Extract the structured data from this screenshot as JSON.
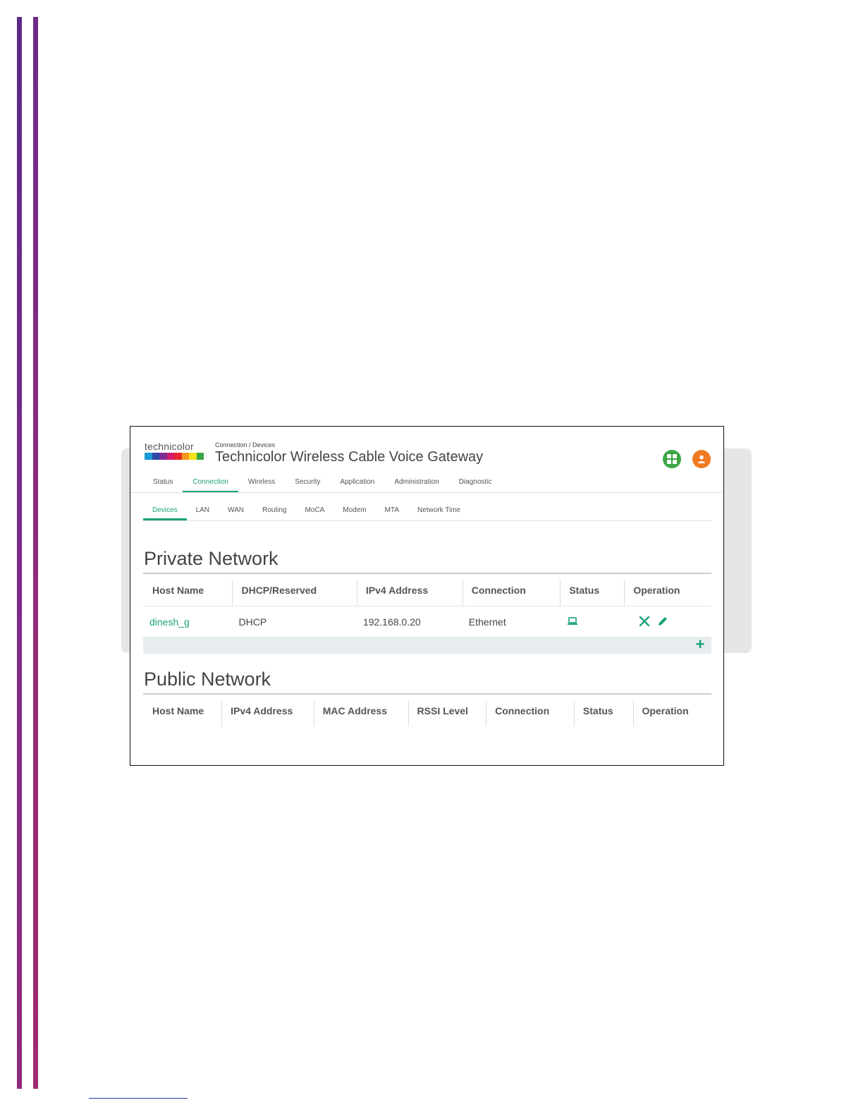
{
  "app": {
    "logo_text": "technicolor",
    "breadcrumb": "Connection / Devices",
    "title": "Technicolor Wireless Cable Voice Gateway",
    "brand_color": "#1aa17a",
    "logo_stripe_colors": [
      "#1b9ad6",
      "#2c4aa6",
      "#7b2d8e",
      "#d61c6c",
      "#e8262b",
      "#f39a1e",
      "#f6e11d",
      "#3aa544"
    ]
  },
  "header_icons": [
    {
      "name": "grid-icon",
      "color": "#3aa544"
    },
    {
      "name": "user-icon",
      "color": "#f07a1f"
    }
  ],
  "main_nav": {
    "items": [
      "Status",
      "Connection",
      "Wireless",
      "Security",
      "Application",
      "Administration",
      "Diagnostic"
    ],
    "active": "Connection"
  },
  "sub_nav": {
    "items": [
      "Devices",
      "LAN",
      "WAN",
      "Routing",
      "MoCA",
      "Modem",
      "MTA",
      "Network Time"
    ],
    "active": "Devices"
  },
  "private_network": {
    "title": "Private Network",
    "columns": [
      "Host Name",
      "DHCP/Reserved",
      "IPv4 Address",
      "Connection",
      "Status",
      "Operation"
    ],
    "rows": [
      {
        "host_name": "dinesh_g",
        "dhcp_reserved": "DHCP",
        "ipv4": "192.168.0.20",
        "connection": "Ethernet",
        "status_icon": "laptop-icon",
        "operations": [
          "delete-icon",
          "edit-icon"
        ]
      }
    ],
    "add_icon": "plus-icon"
  },
  "public_network": {
    "title": "Public Network",
    "columns": [
      "Host Name",
      "IPv4 Address",
      "MAC Address",
      "RSSI Level",
      "Connection",
      "Status",
      "Operation"
    ]
  }
}
